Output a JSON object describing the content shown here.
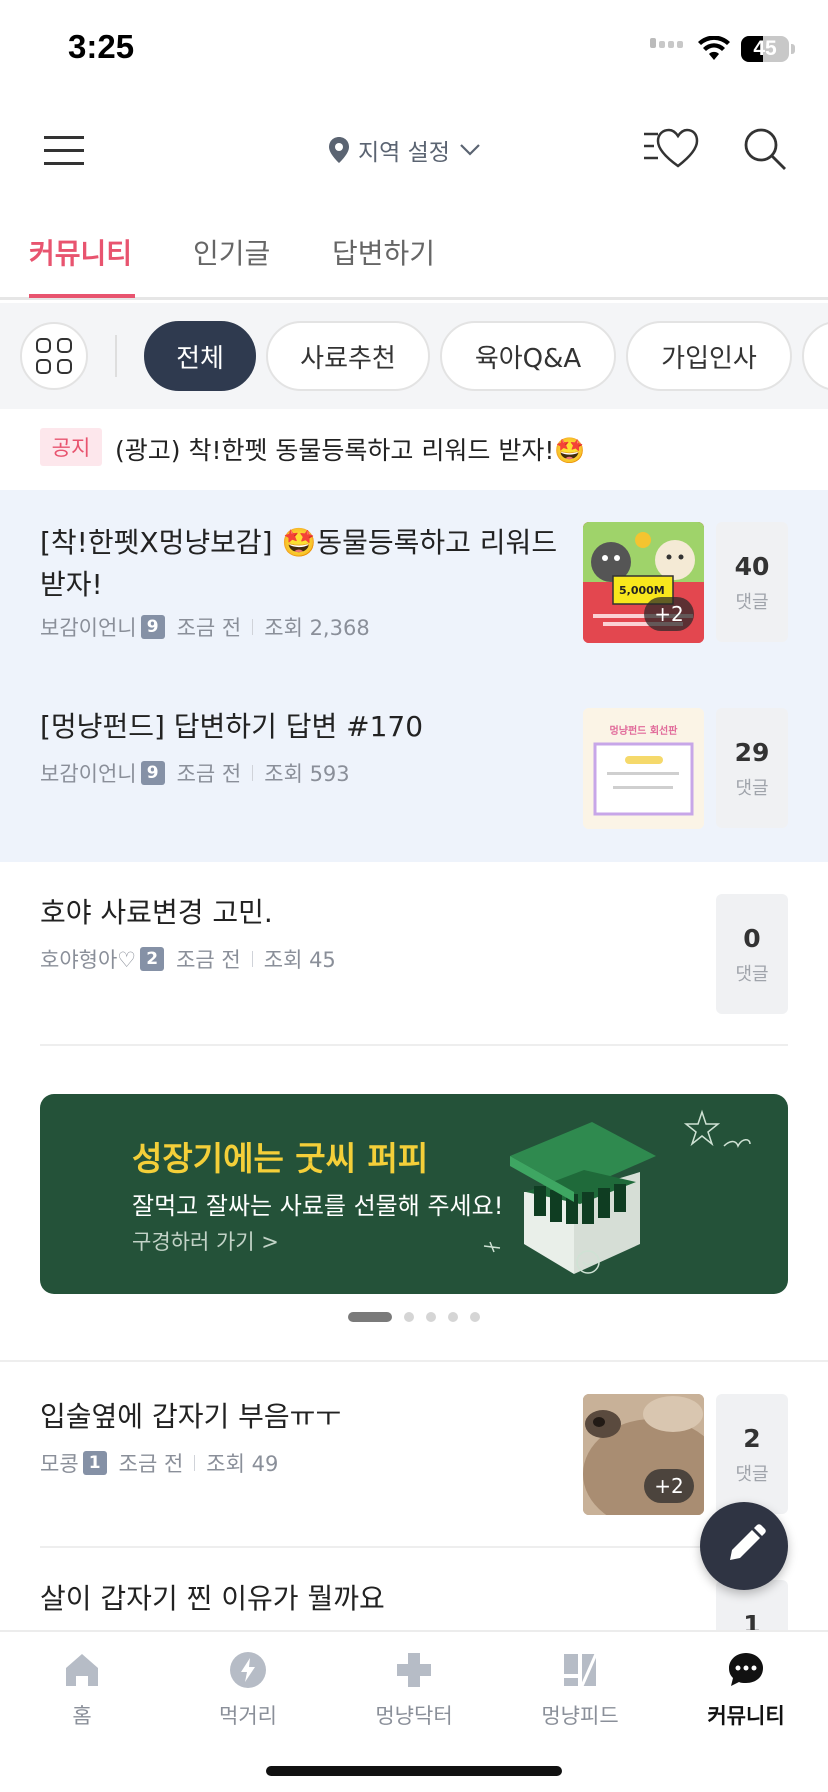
{
  "status_bar": {
    "time": "3:25",
    "battery": "45",
    "battery_level": 0.45
  },
  "top_nav": {
    "region_label": "지역 설정"
  },
  "main_tabs": [
    {
      "label": "커뮤니티",
      "active": true
    },
    {
      "label": "인기글",
      "active": false
    },
    {
      "label": "답변하기",
      "active": false
    }
  ],
  "chips": [
    {
      "label": "전체",
      "active": true
    },
    {
      "label": "사료추천",
      "active": false
    },
    {
      "label": "육아Q&A",
      "active": false
    },
    {
      "label": "가입인사",
      "active": false
    }
  ],
  "notice": {
    "badge": "공지",
    "text": "(광고) 착!한펫 동물등록하고 리워드 받자!🤩"
  },
  "posts": [
    {
      "title": "[착!한펫X멍냥보감] 🤩동물등록하고 리워드 받자!",
      "author": "보감이언니",
      "level": "9",
      "time": "조금 전",
      "views": "조회 2,368",
      "comments": "40",
      "comment_label": "댓글",
      "thumb_more": "+2",
      "pinned": true,
      "thumb_text": "5,000M"
    },
    {
      "title": "[멍냥펀드] 답변하기 답변 #170",
      "author": "보감이언니",
      "level": "9",
      "time": "조금 전",
      "views": "조회 593",
      "comments": "29",
      "comment_label": "댓글",
      "pinned": true,
      "thumb_text": "멍냥펀드 회선판"
    },
    {
      "title": "호야 사료변경 고민.",
      "author": "호야형아♡",
      "level": "2",
      "time": "조금 전",
      "views": "조회 45",
      "comments": "0",
      "comment_label": "댓글",
      "pinned": false
    },
    {
      "title": "입술옆에 갑자기 부음ㅠㅜ",
      "author": "모콩",
      "level": "1",
      "time": "조금 전",
      "views": "조회 49",
      "comments": "2",
      "comment_label": "댓글",
      "thumb_more": "+2",
      "pinned": false
    },
    {
      "title": "살이 갑자기 찐 이유가 뭘까요",
      "comments": "1",
      "pinned": false
    }
  ],
  "banner": {
    "title": "성장기에는 굿씨 퍼피",
    "subtitle": "잘먹고 잘싸는 사료를 선물해 주세요!",
    "link": "구경하러 가기 >",
    "page_count": 5,
    "current_page": 1
  },
  "bottom_nav": [
    {
      "label": "홈",
      "icon": "home-icon",
      "active": false
    },
    {
      "label": "먹거리",
      "icon": "lightning-icon",
      "active": false
    },
    {
      "label": "멍냥닥터",
      "icon": "medical-cross-icon",
      "active": false
    },
    {
      "label": "멍냥피드",
      "icon": "feed-icon",
      "active": false
    },
    {
      "label": "커뮤니티",
      "icon": "chat-bubble-icon",
      "active": true
    }
  ],
  "colors": {
    "accent": "#e8546f",
    "dark_chip": "#2f3a4f",
    "banner_bg": "#245239",
    "banner_title": "#f4cf39",
    "pinned_bg": "#eef3fb"
  }
}
